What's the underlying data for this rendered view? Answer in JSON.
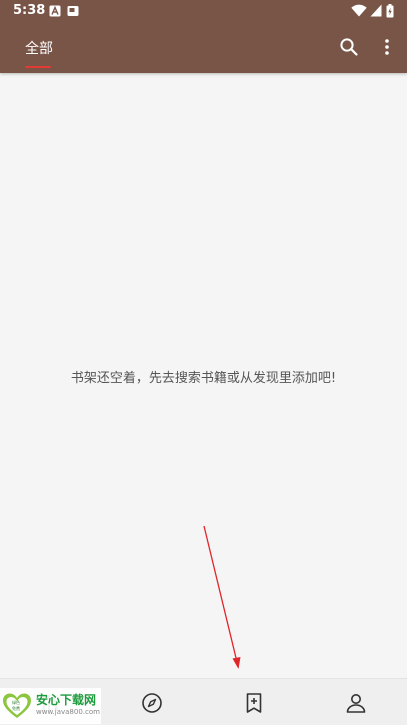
{
  "status_bar": {
    "time": "5:38"
  },
  "toolbar": {
    "tab_label": "全部"
  },
  "bookshelf": {
    "empty_message": "书架还空着，先去搜索书籍或从发现里添加吧!"
  },
  "watermark": {
    "title": "安心下载网",
    "url": "www.java800.com",
    "logo_text_top": "绿色",
    "logo_text_bottom": "免费"
  },
  "colors": {
    "toolbar_bg": "#795548",
    "tab_indicator": "#e53935",
    "annotation_arrow": "#e0242a"
  }
}
